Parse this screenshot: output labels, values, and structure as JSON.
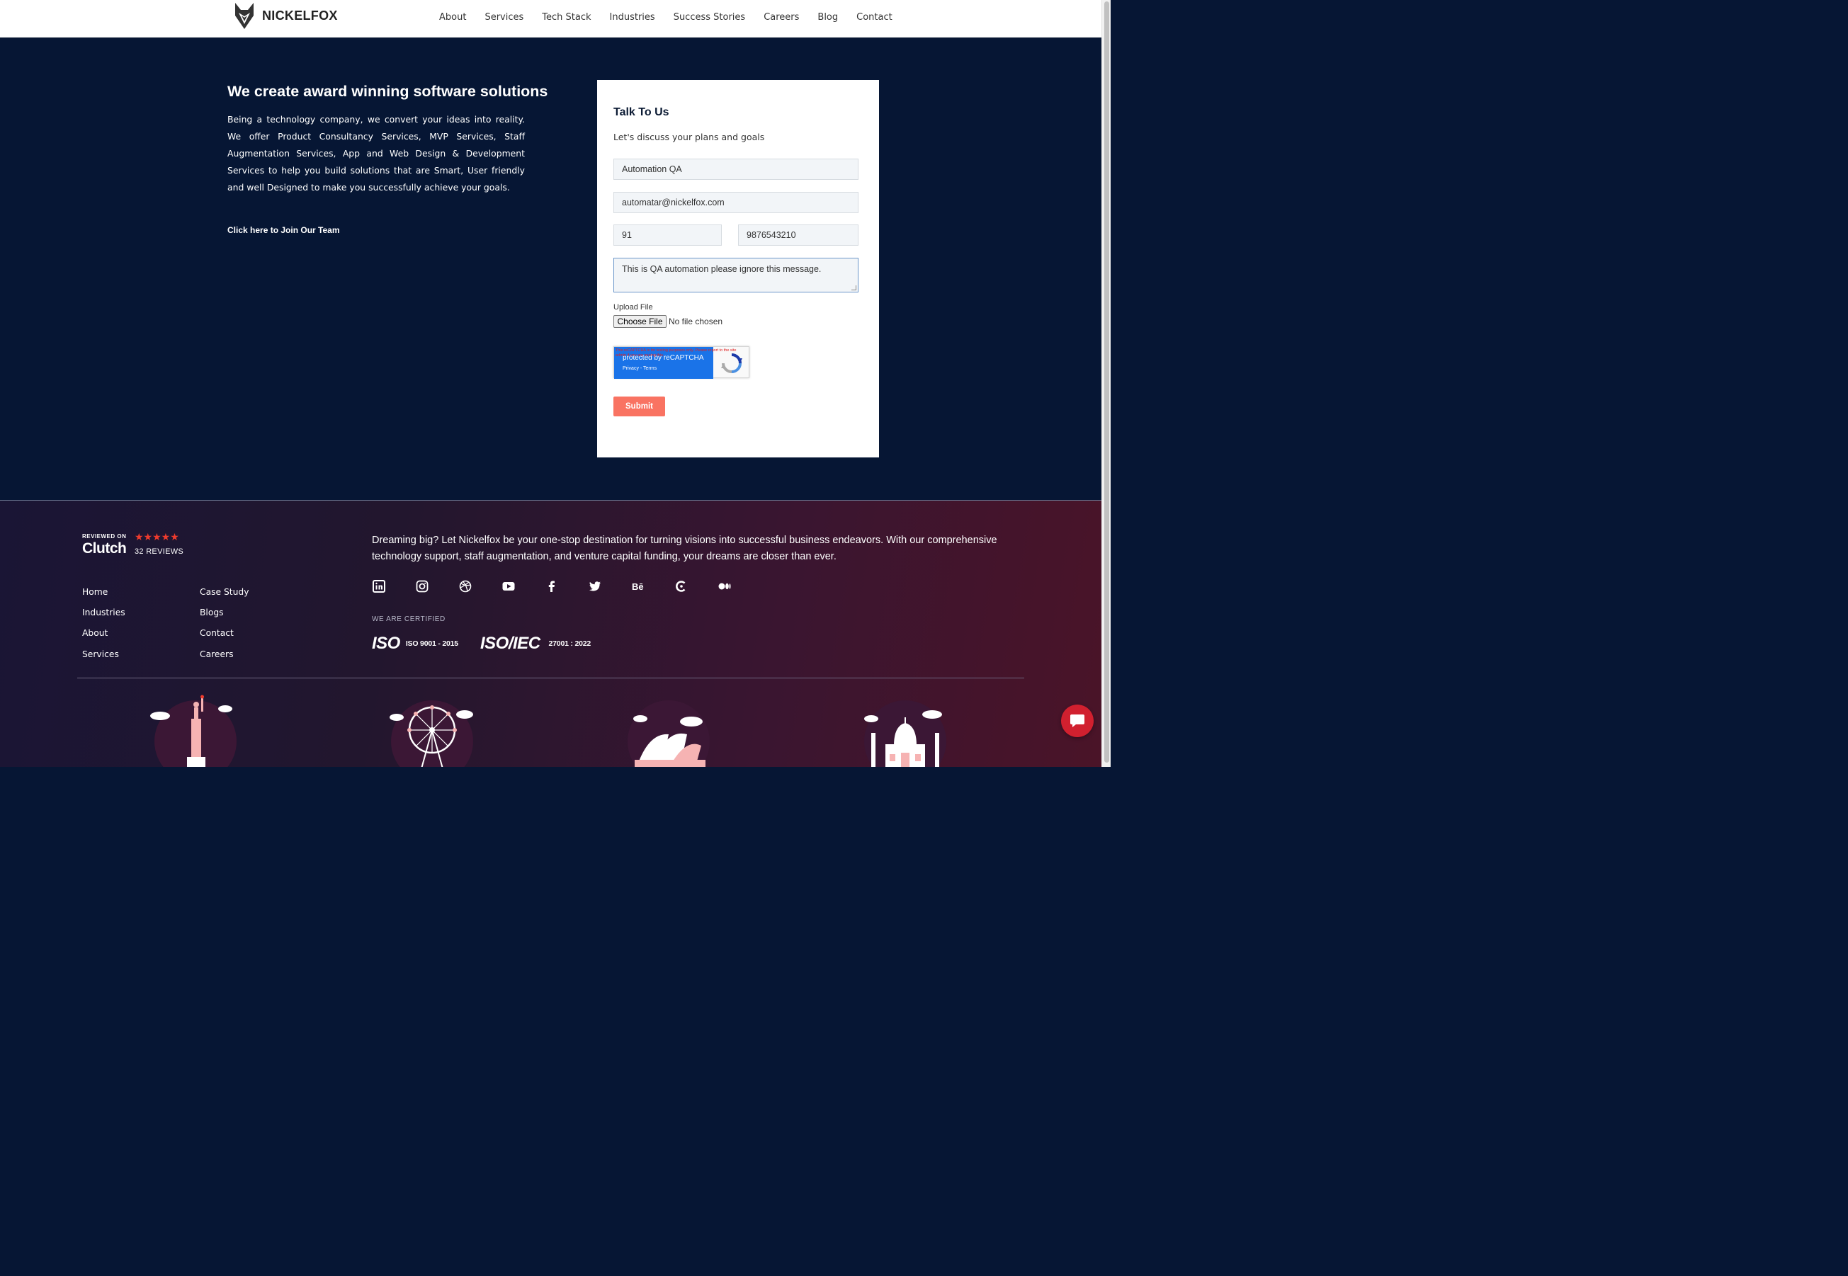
{
  "brand": {
    "name": "NICKELFOX"
  },
  "nav": [
    "About",
    "Services",
    "Tech Stack",
    "Industries",
    "Success Stories",
    "Careers",
    "Blog",
    "Contact"
  ],
  "hero": {
    "title": "We create award winning software solutions",
    "description": "Being a technology company, we convert your ideas into reality. We offer Product Consultancy Services, MVP Services, Staff Augmentation Services, App and Web Design & Development Services to help you build solutions that are Smart, User friendly and well Designed to make you successfully achieve your goals.",
    "join_link": "Click here to Join Our Team"
  },
  "form": {
    "title": "Talk To Us",
    "subtitle": "Let's discuss your plans and goals",
    "name_value": "Automation QA",
    "email_value": "automatar@nickelfox.com",
    "country_code_value": "91",
    "phone_value": "9876543210",
    "message_value": "This is QA automation please ignore this message.",
    "upload_label": "Upload File",
    "choose_file_label": "Choose File",
    "no_file_text": "No file chosen",
    "recaptcha_warning": "This reCAPTCHA is for testing purposes only. Please report to the site admin if you are seeing this.",
    "recaptcha_label": "protected by reCAPTCHA",
    "recaptcha_links": "Privacy - Terms",
    "submit_label": "Submit"
  },
  "footer": {
    "clutch": {
      "reviewed_on": "REVIEWED ON",
      "brand": "Clutch",
      "stars": "★★★★★",
      "reviews": "32 REVIEWS"
    },
    "links_col1": [
      "Home",
      "Industries",
      "About",
      "Services"
    ],
    "links_col2": [
      "Case Study",
      "Blogs",
      "Contact",
      "Careers"
    ],
    "tagline": "Dreaming big? Let Nickelfox be your one-stop destination for turning visions into successful business endeavors. With our comprehensive technology support, staff augmentation, and venture capital funding, your dreams are closer than ever.",
    "socials": [
      "linkedin-icon",
      "instagram-icon",
      "dribbble-icon",
      "youtube-icon",
      "facebook-icon",
      "twitter-icon",
      "behance-icon",
      "clutch-icon",
      "medium-icon"
    ],
    "certified_title": "WE ARE CERTIFIED",
    "certs": [
      {
        "mark": "ISO",
        "number": "ISO 9001 - 2015"
      },
      {
        "mark": "ISO/IEC",
        "number": "27001 : 2022"
      }
    ],
    "landmarks": [
      "statue-of-liberty-icon",
      "london-eye-icon",
      "sydney-opera-house-icon",
      "taj-mahal-icon"
    ]
  },
  "colors": {
    "hero_bg": "#061634",
    "accent": "#f97362",
    "chat": "#d1202f",
    "clutch_star": "#ef3b2d"
  }
}
